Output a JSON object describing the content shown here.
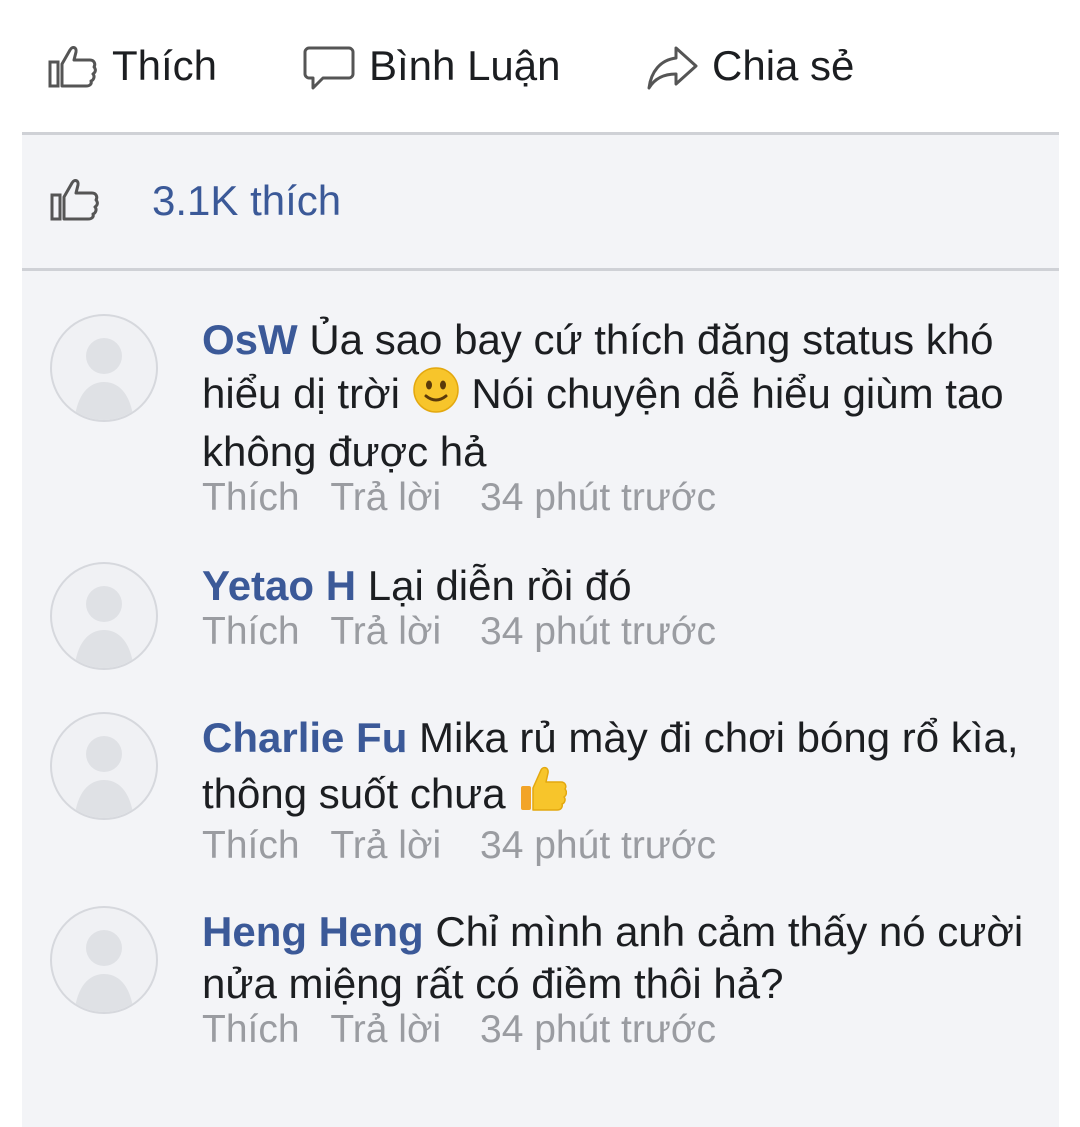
{
  "actions": {
    "like_label": "Thích",
    "comment_label": "Bình Luận",
    "share_label": "Chia sẻ"
  },
  "likes": {
    "count_label": "3.1K thích"
  },
  "comments": [
    {
      "author": "OsW",
      "text_before_emoji": "Ủa sao bay cứ thích đăng status khó hiểu dị trời",
      "emoji": "slightly-smiling-face",
      "text_after_emoji": "Nói chuyện dễ hiểu giùm tao không được hả",
      "like_label": "Thích",
      "reply_label": "Trả lời",
      "time": "34 phút trước"
    },
    {
      "author": "Yetao H",
      "text": "Lại diễn rồi đó",
      "like_label": "Thích",
      "reply_label": "Trả lời",
      "time": "34 phút trước"
    },
    {
      "author": "Charlie Fu",
      "text_before_emoji": "Mika rủ mày đi chơi bóng rổ kìa, thông suốt chưa",
      "emoji": "thumbs-up",
      "like_label": "Thích",
      "reply_label": "Trả lời",
      "time": "34 phút trước"
    },
    {
      "author": "Heng Heng",
      "text": "Chỉ mình anh cảm thấy nó cười nửa miệng rất có điềm thôi hả?",
      "like_label": "Thích",
      "reply_label": "Trả lời",
      "time": "34 phút trước"
    }
  ],
  "colors": {
    "link_blue": "#3b5998",
    "meta_grey": "#9a9ca1",
    "panel_bg": "#f3f4f7",
    "divider": "#cfd1d6"
  }
}
